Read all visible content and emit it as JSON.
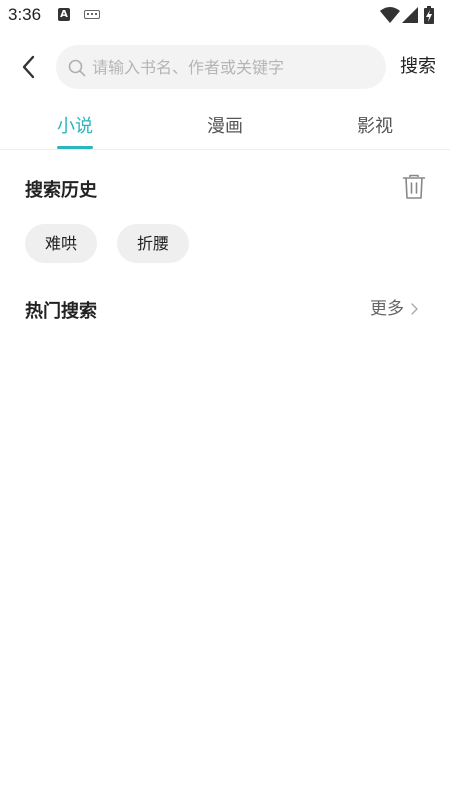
{
  "status_bar": {
    "time": "3:36",
    "app_icon_letter": "A"
  },
  "header": {
    "search_placeholder": "请输入书名、作者或关键字",
    "search_value": "",
    "search_label": "搜索"
  },
  "tabs": [
    {
      "label": "小说",
      "active": true
    },
    {
      "label": "漫画",
      "active": false
    },
    {
      "label": "影视",
      "active": false
    }
  ],
  "search_history": {
    "title": "搜索历史",
    "items": [
      "难哄",
      "折腰"
    ]
  },
  "hot_search": {
    "title": "热门搜索",
    "more_label": "更多"
  },
  "colors": {
    "accent": "#2bb5bd",
    "chip_bg": "#efefef",
    "search_bg": "#f3f3f3"
  }
}
